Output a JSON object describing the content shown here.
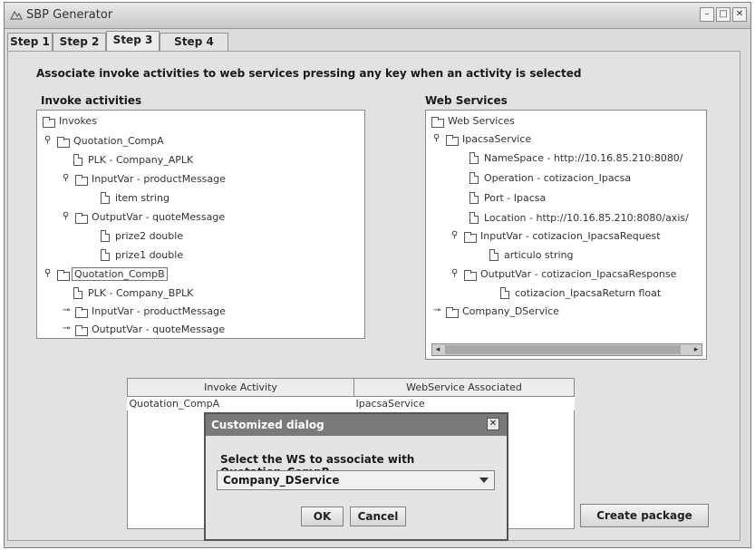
{
  "window": {
    "title": "SBP Generator",
    "icon": "app-icon"
  },
  "tabs": [
    "Step 1",
    "Step 2",
    "Step 3",
    "Step 4"
  ],
  "instruction": "Associate invoke activities to web services pressing any key when an activity is selected",
  "invoke_title": "Invoke activities",
  "ws_title": "Web Services",
  "invoke_tree": [
    "Invokes",
    "Quotation_CompA",
    "PLK - Company_APLK",
    "InputVar - productMessage",
    "item string",
    "OutputVar - quoteMessage",
    "prize2 double",
    "prize1 double",
    "Quotation_CompB",
    "PLK - Company_BPLK",
    "InputVar - productMessage",
    "OutputVar - quoteMessage"
  ],
  "ws_tree": [
    "Web Services",
    "IpacsaService",
    "NameSpace - http://10.16.85.210:8080/",
    "Operation - cotizacion_Ipacsa",
    "Port - Ipacsa",
    "Location - http://10.16.85.210:8080/axis/",
    "InputVar - cotizacion_IpacsaRequest",
    "articulo string",
    "OutputVar - cotizacion_IpacsaResponse",
    "cotizacion_IpacsaReturn float",
    "Company_DService"
  ],
  "table": {
    "headers": [
      "Invoke Activity",
      "WebService Associated"
    ],
    "rows": [
      [
        "Quotation_CompA",
        "IpacsaService"
      ]
    ]
  },
  "dialog": {
    "title": "Customized dialog",
    "message": "Select the WS to associate with Quotation_CompB",
    "selected": "Company_DService",
    "ok": "OK",
    "cancel": "Cancel"
  },
  "create_package": "Create package"
}
